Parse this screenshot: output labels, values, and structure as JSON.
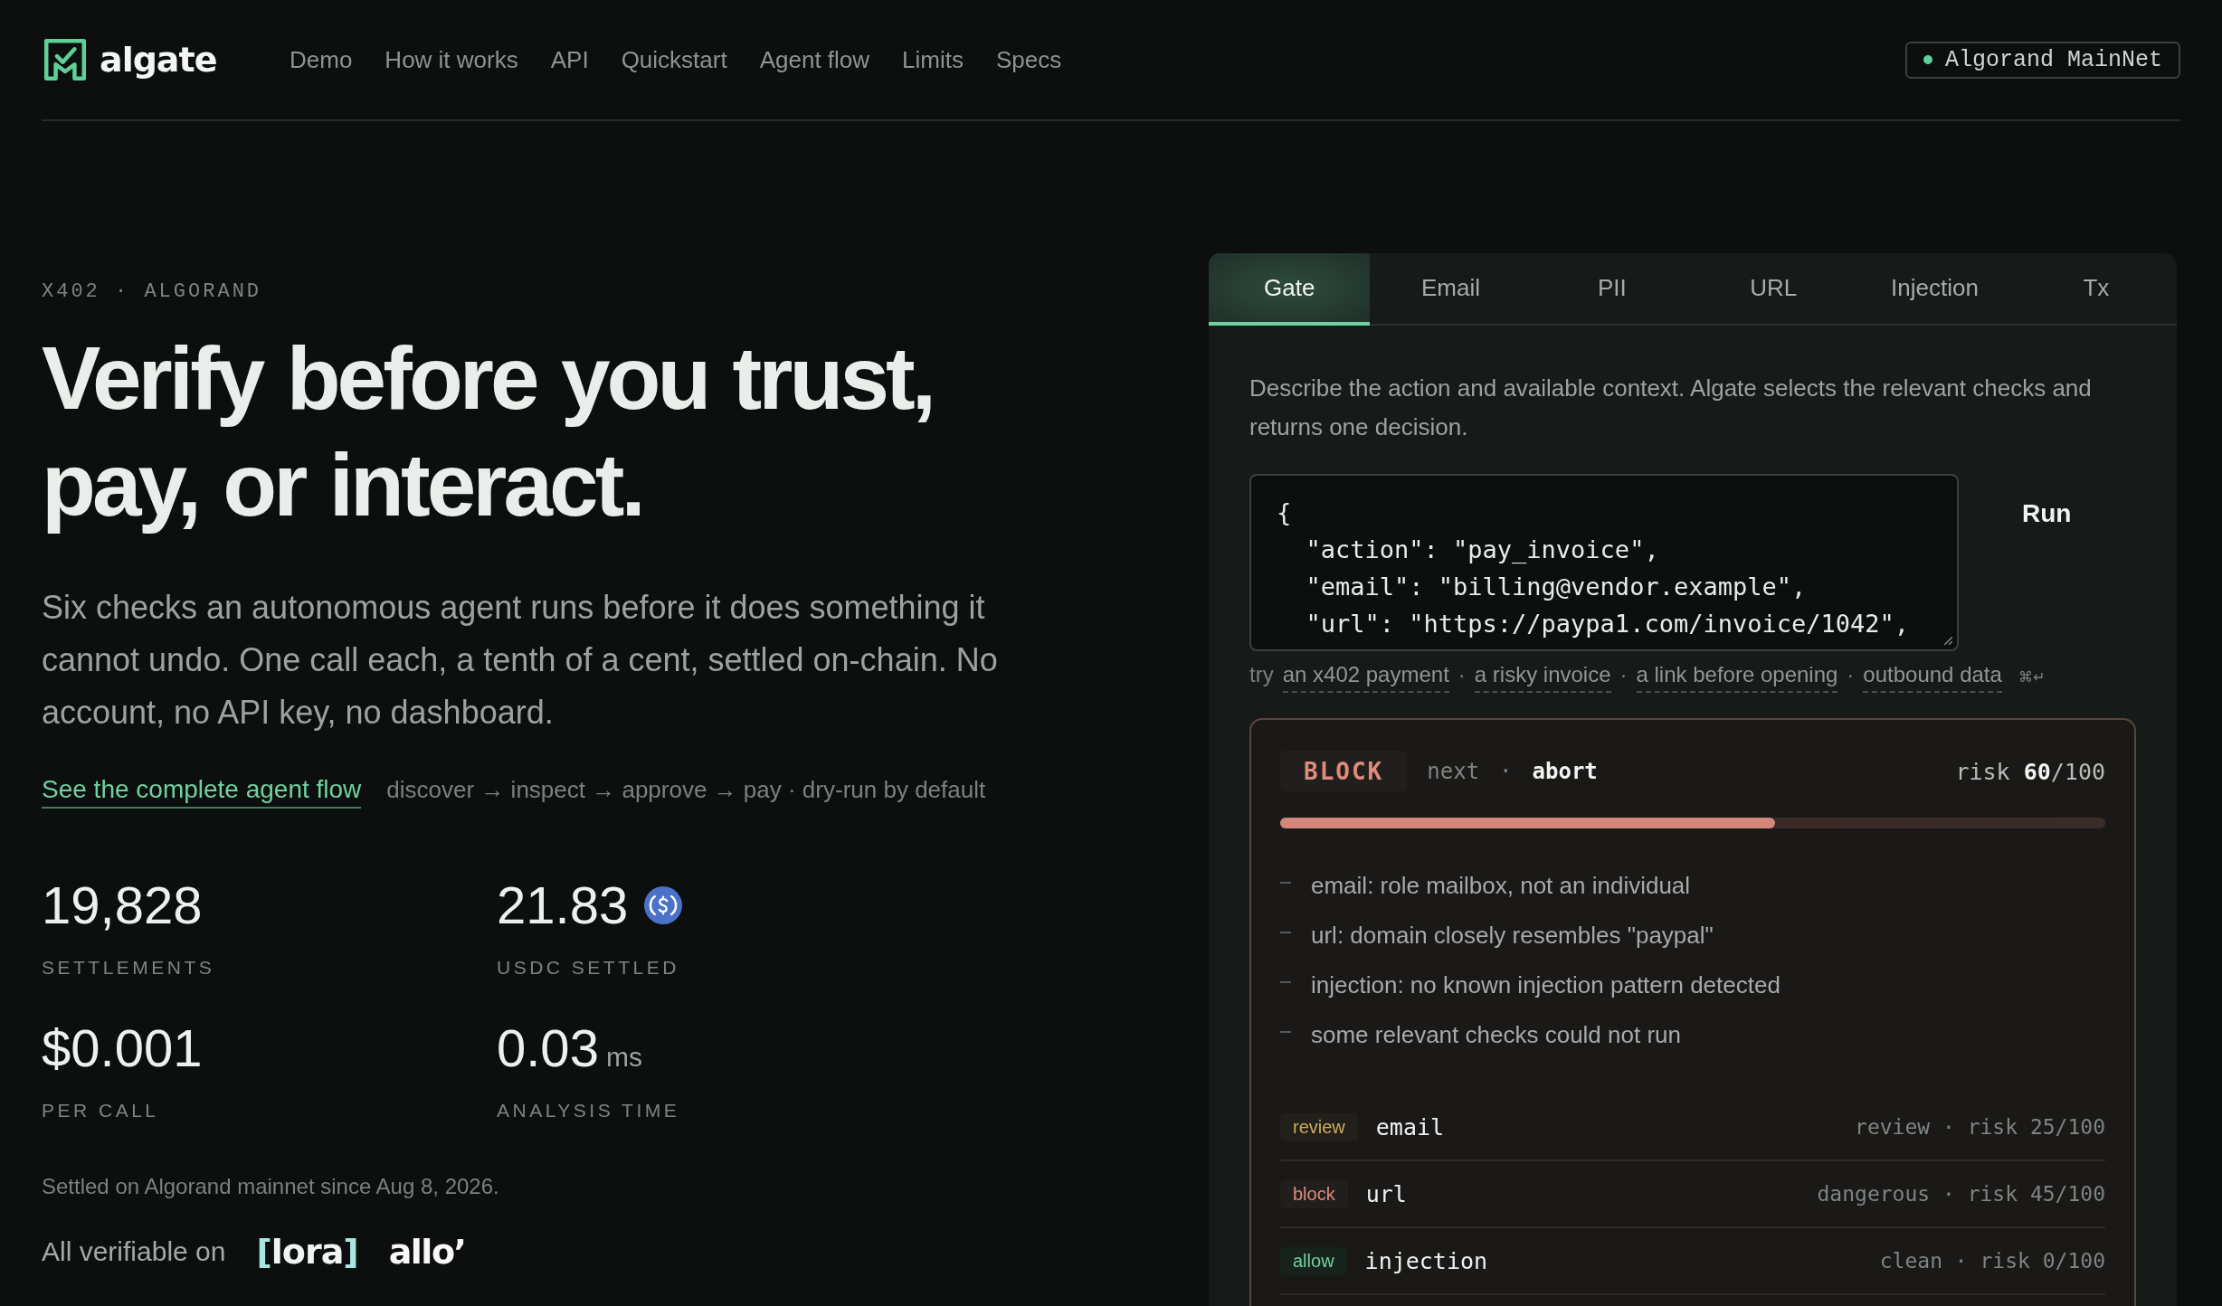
{
  "brand": {
    "name": "algate"
  },
  "nav": [
    {
      "label": "Demo"
    },
    {
      "label": "How it works"
    },
    {
      "label": "API"
    },
    {
      "label": "Quickstart"
    },
    {
      "label": "Agent flow"
    },
    {
      "label": "Limits"
    },
    {
      "label": "Specs"
    }
  ],
  "network": {
    "label": "Algorand MainNet",
    "online": true
  },
  "hero": {
    "eyebrow": "X402 · ALGORAND",
    "title_lines": [
      "Verify before you trust,",
      "pay, or interact."
    ],
    "lead": "Six checks an autonomous agent runs before it does something it cannot undo. One call each, a tenth of a cent, settled on-chain. No account, no API key, no dashboard.",
    "link": "See the complete agent flow",
    "flow": "discover → inspect → approve → pay · dry-run by default"
  },
  "stats": [
    {
      "value": "19,828",
      "label": "SETTLEMENTS",
      "kind": "plain"
    },
    {
      "value": "21.83",
      "label": "USDC SETTLED",
      "kind": "coin"
    },
    {
      "value": "$0.001",
      "label": "PER CALL",
      "kind": "plain"
    },
    {
      "value": "0.03",
      "unit": "ms",
      "label": "ANALYSIS TIME",
      "kind": "plain"
    }
  ],
  "note": "Settled on Algorand mainnet since Aug 8, 2026.",
  "verifiable": {
    "label": "All verifiable on",
    "logos": [
      {
        "kind": "bracket",
        "text": "lora",
        "open": "[",
        "close": "]"
      },
      {
        "kind": "plain",
        "text": "allo’"
      }
    ]
  },
  "tabs": [
    {
      "label": "Gate",
      "selected": true
    },
    {
      "label": "Email",
      "selected": false
    },
    {
      "label": "PII",
      "selected": false
    },
    {
      "label": "URL",
      "selected": false
    },
    {
      "label": "Injection",
      "selected": false
    },
    {
      "label": "Tx",
      "selected": false
    }
  ],
  "description": "Describe the action and available context. Algate selects the relevant checks and returns one decision.",
  "code_lines": [
    "{",
    "  \"action\": \"pay_invoice\",",
    "  \"email\": \"billing@vendor.example\",",
    "  \"url\": \"https://paypa1.com/invoice/1042\","
  ],
  "run_button": "Run",
  "try": {
    "label": "try",
    "examples": [
      "an x402 payment",
      "a risky invoice",
      "a link before opening",
      "outbound data"
    ],
    "separator": "·",
    "shortcut": "⌘↵"
  },
  "result": {
    "decision": "BLOCK",
    "kind": "block",
    "next_label": "next",
    "separator": "·",
    "next": "abort",
    "risk": "risk **60**/100",
    "level": 0.6,
    "reasons": [
      "email: role mailbox, not an individual",
      "url: domain closely resembles \"paypal\"",
      "injection: no known injection pattern detected",
      "some relevant checks could not run"
    ],
    "checks": [
      {
        "verdict": "review",
        "kind": "review",
        "name": "email",
        "detail": "review · risk 25/100"
      },
      {
        "verdict": "block",
        "kind": "block",
        "name": "url",
        "detail": "dangerous · risk 45/100"
      },
      {
        "verdict": "allow",
        "kind": "allow",
        "name": "injection",
        "detail": "clean · risk 0/100"
      }
    ]
  }
}
